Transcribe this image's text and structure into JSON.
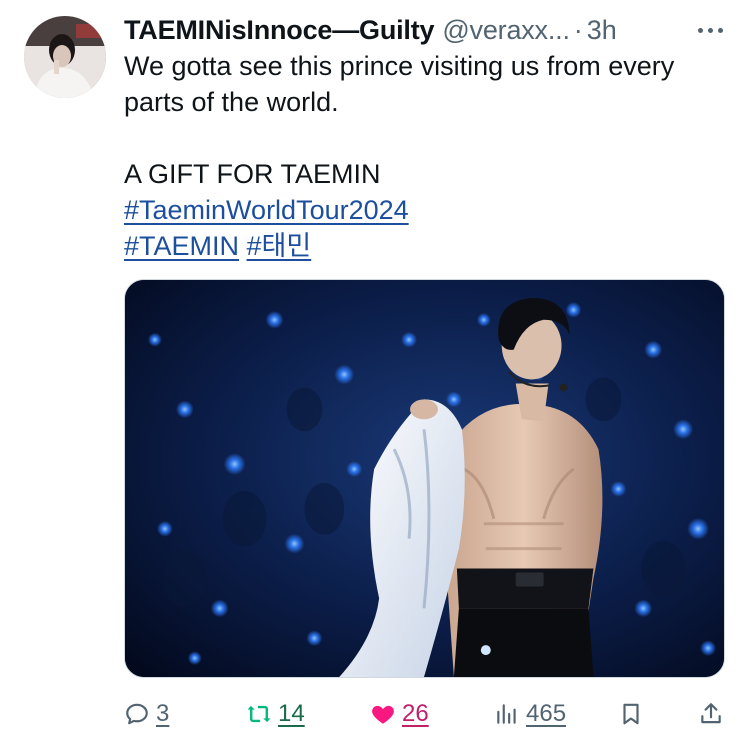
{
  "tweet": {
    "author": {
      "display_name": "TAEMINisInnoce—Guilty",
      "handle": "@veraxx...",
      "separator": "·",
      "time": "3h"
    },
    "text": {
      "line1": "We gotta see this prince visiting us from every parts of the world.",
      "line2": "A GIFT FOR TAEMIN",
      "hashtag1": "#TaeminWorldTour2024",
      "hashtag2": "#TAEMIN",
      "hashtag3": "#태민"
    },
    "icons": {
      "more": "more-horizontal-icon",
      "reply": "reply-icon",
      "retweet": "retweet-icon",
      "like": "heart-icon",
      "views": "views-icon",
      "bookmark": "bookmark-icon",
      "share": "share-icon"
    },
    "stats": {
      "replies": "3",
      "retweets": "14",
      "likes": "26",
      "views": "465"
    },
    "colors": {
      "link": "#1d4f9e",
      "retweet": "#00ba7c",
      "like": "#f91880",
      "muted": "#536471"
    }
  }
}
